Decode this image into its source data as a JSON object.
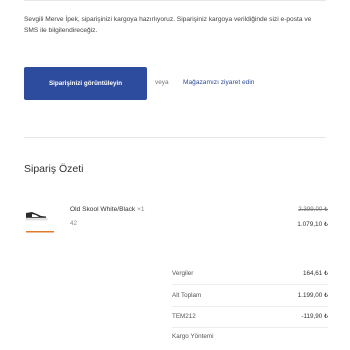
{
  "message": {
    "text": "Sevgili Merve İpek, siparişinizi kargoya hazırlıyoruz. Siparişiniz kargoya verildiğinde sizi e-posta ve SMS ile bilgilendireceğiz."
  },
  "actions": {
    "view_order_label": "Siparişinizi görüntüleyin",
    "or_label": "veya",
    "visit_store_label": "Mağazamızı ziyaret edin"
  },
  "summary": {
    "title": "Sipariş Özeti",
    "items": [
      {
        "name": "Old Skool White/Black",
        "quantity": "×1",
        "size": "42",
        "original_price": "2.399,00 ₺",
        "price": "1.079,10 ₺"
      }
    ],
    "totals": [
      {
        "label": "Vergiler",
        "value": "164,61 ₺"
      },
      {
        "label": "Alt Toplam",
        "value": "1.199,00 ₺"
      },
      {
        "label": "TEM212",
        "value": "-119,90 ₺"
      },
      {
        "label": "Kargo Yöntemi",
        "value": ""
      }
    ]
  }
}
